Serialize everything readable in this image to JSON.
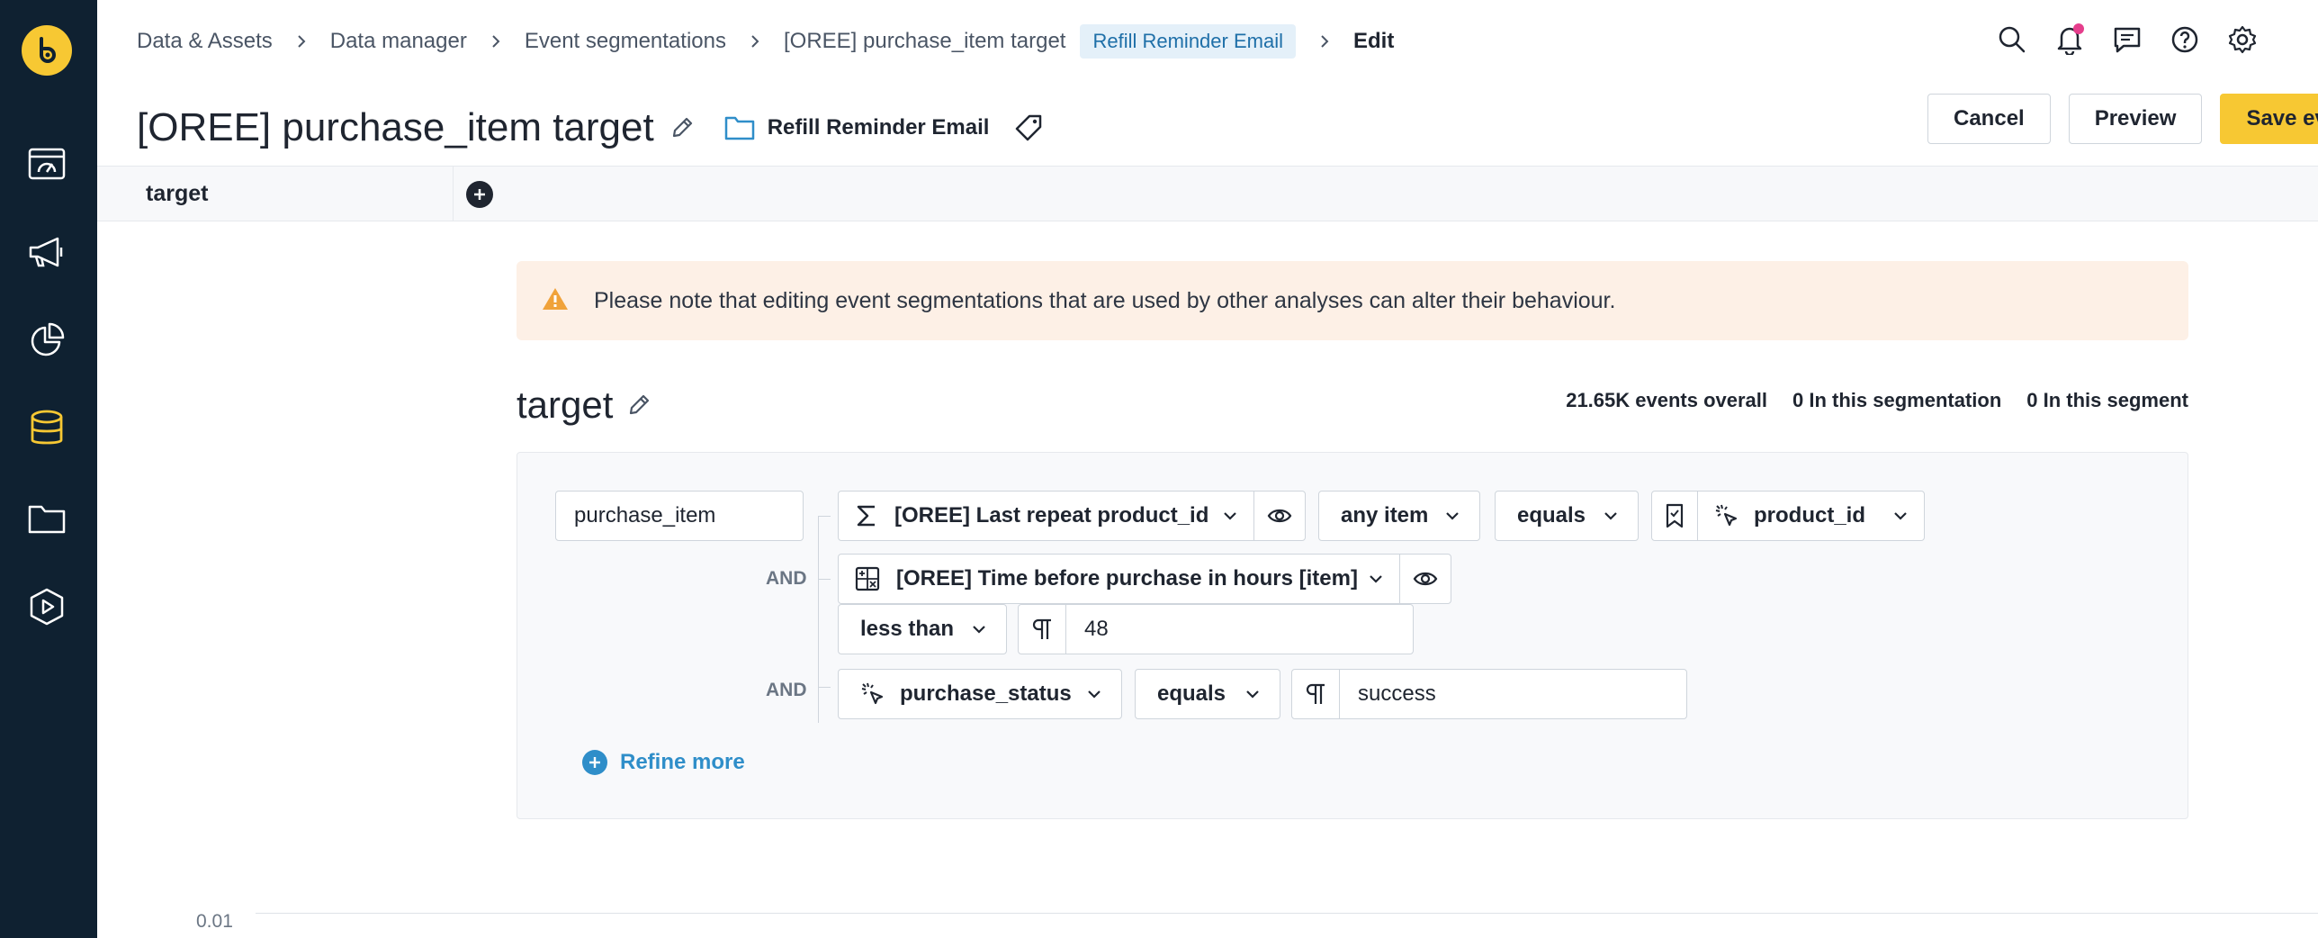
{
  "breadcrumb": {
    "items": [
      "Data & Assets",
      "Data manager",
      "Event segmentations",
      "[OREE] purchase_item target"
    ],
    "badge": "Refill Reminder Email",
    "current": "Edit"
  },
  "header": {
    "title": "[OREE] purchase_item target",
    "folder": "Refill Reminder Email",
    "cancel": "Cancel",
    "preview": "Preview",
    "save": "Save eve"
  },
  "tabs": [
    {
      "label": "target"
    }
  ],
  "alert": {
    "text": "Please note that editing event segmentations that are used by other analyses can alter their behaviour."
  },
  "segment": {
    "title": "target",
    "stats": {
      "overall": "21.65K events overall",
      "segmentation": "0 In this segmentation",
      "segment": "0 In this segment"
    },
    "event": "purchase_item",
    "and_label": "AND",
    "row1": {
      "attribute": "[OREE] Last repeat product_id",
      "quantifier": "any item",
      "operator": "equals",
      "value": "product_id"
    },
    "row2": {
      "attribute": "[OREE] Time before purchase in hours [item]",
      "operator": "less than",
      "value": "48"
    },
    "row3": {
      "attribute": "purchase_status",
      "operator": "equals",
      "value": "success"
    },
    "refine_more": "Refine more"
  },
  "chart": {
    "y_tick": "0.01"
  },
  "colors": {
    "sidebar": "#0f2131",
    "accent": "#f7c833",
    "link": "#2f8ec9",
    "alert_bg": "#fdf0e6",
    "warning": "#f0a23a",
    "notification": "#e53e8c"
  }
}
